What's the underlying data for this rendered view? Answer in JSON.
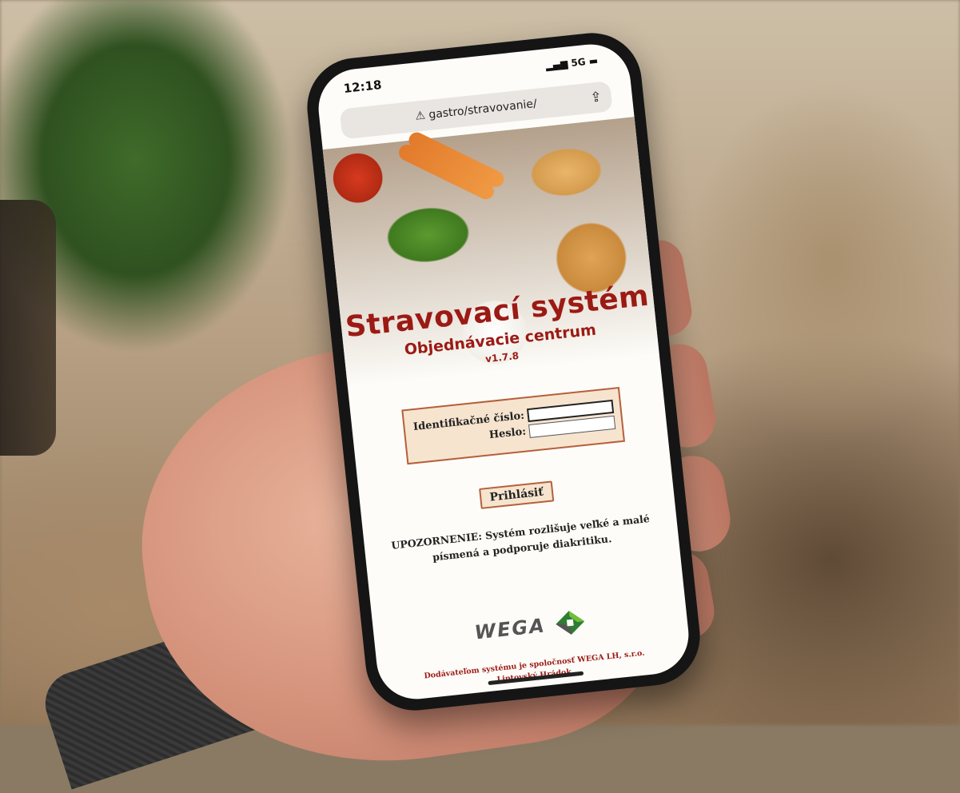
{
  "status_bar": {
    "time": "12:18",
    "network": "5G"
  },
  "browser": {
    "address": "gastro/stravovanie/",
    "share_icon": "share-icon",
    "warning_icon": "warning-icon"
  },
  "app": {
    "title": "Stravovací systém",
    "subtitle": "Objednávacie centrum",
    "version": "v1.7.8"
  },
  "login": {
    "id_label": "Identifikačné číslo:",
    "id_value": "",
    "password_label": "Heslo:",
    "password_value": "",
    "submit_label": "Prihlásiť"
  },
  "notice": {
    "line1": "UPOZORNENIE: Systém rozlišuje veľké a malé",
    "line2": "písmená a podporuje diakritiku."
  },
  "brand": {
    "logo_text": "WEGA",
    "logo_accent": "#2e7d32"
  },
  "footer": {
    "line1": "Dodávateľom systému je spoločnosť WEGA LH, s.r.o.",
    "line2": "Liptovský Hrádok."
  },
  "colors": {
    "title": "#9c1a14",
    "box_bg": "#f6e4cf",
    "box_border": "#b5603c"
  }
}
